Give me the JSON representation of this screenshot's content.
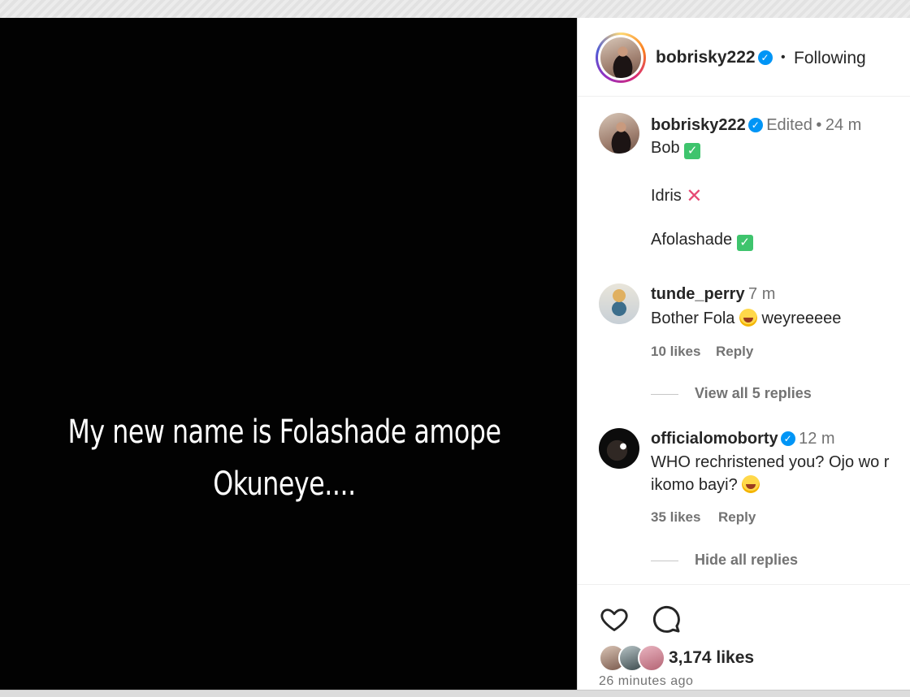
{
  "post": {
    "media_caption_line1": "My new name is Folashade amope",
    "media_caption_line2": "Okuneye....",
    "header": {
      "username": "bobrisky222",
      "separator": "•",
      "follow_status": "Following"
    },
    "caption": {
      "username": "bobrisky222",
      "edited": "Edited",
      "separator": "•",
      "time": "24 m",
      "line1": "Bob",
      "line2": "Idris",
      "line3": "Afolashade"
    },
    "comments": [
      {
        "username": "tunde_perry",
        "time": "7 m",
        "text_before_emoji": "Bother Fola",
        "text_after_emoji": "weyreeeee",
        "likes": "10 likes",
        "reply_label": "Reply",
        "replies_toggle": "View all 5 replies"
      },
      {
        "username": "officialomoborty",
        "time": "12 m",
        "text_line1": "WHO rechristened you? Ojo wo r",
        "text_line2": "ikomo bayi?",
        "likes": "35 likes",
        "reply_label": "Reply",
        "replies_toggle": "Hide all replies"
      }
    ],
    "footer": {
      "likes_count": "3,174 likes",
      "time_ago": "26 minutes ago"
    }
  },
  "icons": {
    "verified": "verified-badge-icon",
    "check": "check-mark-emoji",
    "cross": "cross-mark-emoji",
    "laugh": "laughing-emoji",
    "like": "heart-icon",
    "comment": "speech-bubble-icon"
  },
  "colors": {
    "verified": "#0095f6",
    "muted_text": "#737373",
    "check_green": "#3ec46d",
    "cross_pink": "#e64a74"
  }
}
